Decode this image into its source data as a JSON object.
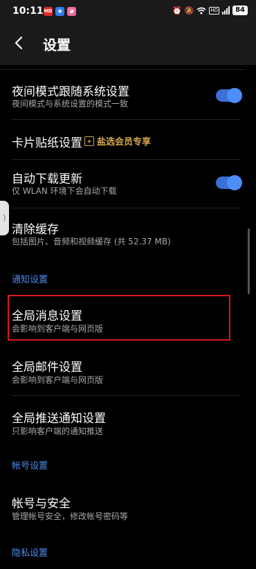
{
  "status_bar": {
    "time": "10:11",
    "apps": [
      {
        "name": "red-app-icon",
        "color": "#e22a2a",
        "glyph": "HD"
      },
      {
        "name": "blue-app-icon",
        "color": "#2d7ff0",
        "glyph": "◉"
      },
      {
        "name": "pink-app-icon",
        "color": "#f06aa0",
        "glyph": "◕"
      }
    ],
    "hd_label": "HD",
    "battery": "84"
  },
  "header": {
    "title": "设置"
  },
  "settings": {
    "night_mode": {
      "title": "夜间模式跟随系统设置",
      "subtitle": "夜间模式与系统设置的模式一致",
      "enabled": true
    },
    "card_sticker": {
      "title": "卡片贴纸设置",
      "badge": "盐选会员专享"
    },
    "auto_update": {
      "title": "自动下载更新",
      "subtitle": "仅 WLAN 环境下会自动下载",
      "enabled": true
    },
    "clear_cache": {
      "title": "清除缓存",
      "subtitle": "包括图片、音频和视频缓存 (共 52.37 MB)"
    }
  },
  "sections": {
    "notifications": {
      "label": "通知设置",
      "items": [
        {
          "title": "全局消息设置",
          "subtitle": "会影响到客户端与网页版"
        },
        {
          "title": "全局邮件设置",
          "subtitle": "会影响到客户端与网页版"
        },
        {
          "title": "全局推送通知设置",
          "subtitle": "只影响客户端的通知推送"
        }
      ]
    },
    "account": {
      "label": "帐号设置",
      "items": [
        {
          "title": "帐号与安全",
          "subtitle": "管理帐号安全，修改帐号密码等"
        }
      ]
    },
    "privacy": {
      "label": "隐私设置"
    }
  },
  "colors": {
    "accent": "#4e8cf0",
    "highlight": "#e0161c",
    "vip": "#d4a850"
  }
}
